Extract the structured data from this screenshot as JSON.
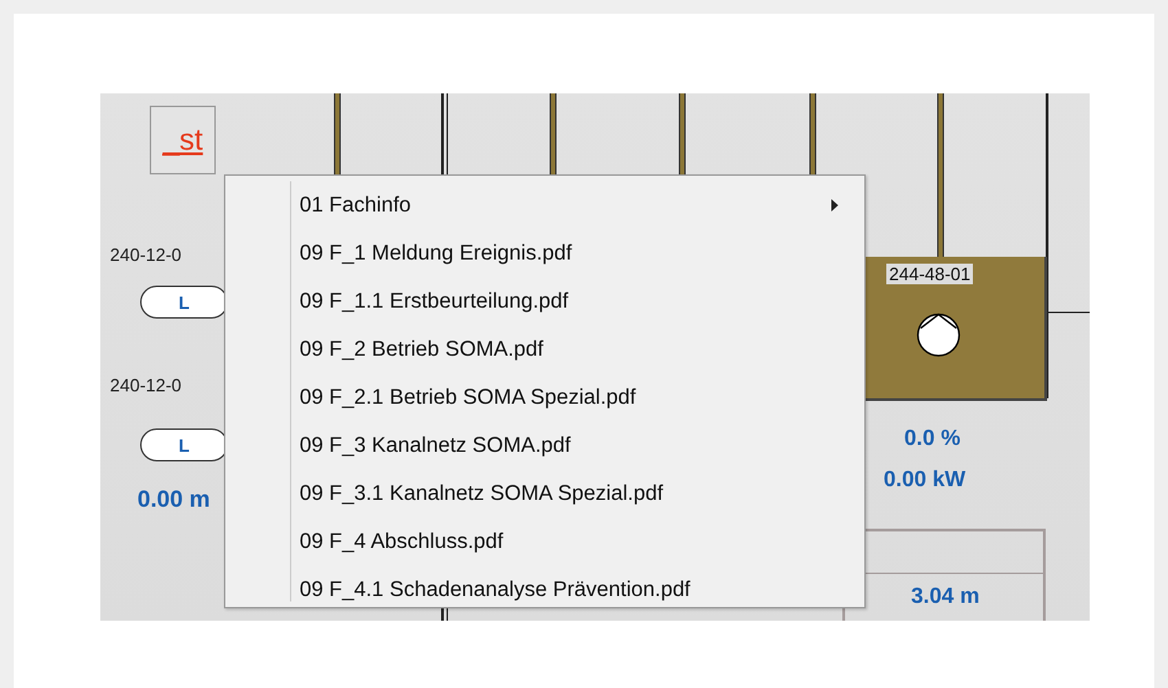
{
  "st_button": {
    "label": "_st"
  },
  "left_panel": [
    {
      "kind": "tag",
      "text": "240-12-0"
    },
    {
      "kind": "pill",
      "text": "L"
    },
    {
      "kind": "tag",
      "text": "240-12-0"
    },
    {
      "kind": "pill",
      "text": "L"
    },
    {
      "kind": "reading",
      "text": "0.00 m"
    }
  ],
  "pump": {
    "tag": "244-48-01",
    "percent": "0.0 %",
    "power": "0.00 kW"
  },
  "level_box": {
    "reading": "3.04 m"
  },
  "context_menu": {
    "items": [
      {
        "label": "01 Fachinfo",
        "submenu": true
      },
      {
        "label": "09 F_1 Meldung Ereignis.pdf",
        "submenu": false
      },
      {
        "label": "09 F_1.1 Erstbeurteilung.pdf",
        "submenu": false
      },
      {
        "label": "09 F_2 Betrieb SOMA.pdf",
        "submenu": false
      },
      {
        "label": "09 F_2.1 Betrieb SOMA Spezial.pdf",
        "submenu": false
      },
      {
        "label": "09 F_3 Kanalnetz SOMA.pdf",
        "submenu": false
      },
      {
        "label": "09 F_3.1 Kanalnetz SOMA Spezial.pdf",
        "submenu": false
      },
      {
        "label": "09 F_4 Abschluss.pdf",
        "submenu": false
      },
      {
        "label": "09 F_4.1 Schadenanalyse Prävention.pdf",
        "submenu": false
      }
    ]
  }
}
